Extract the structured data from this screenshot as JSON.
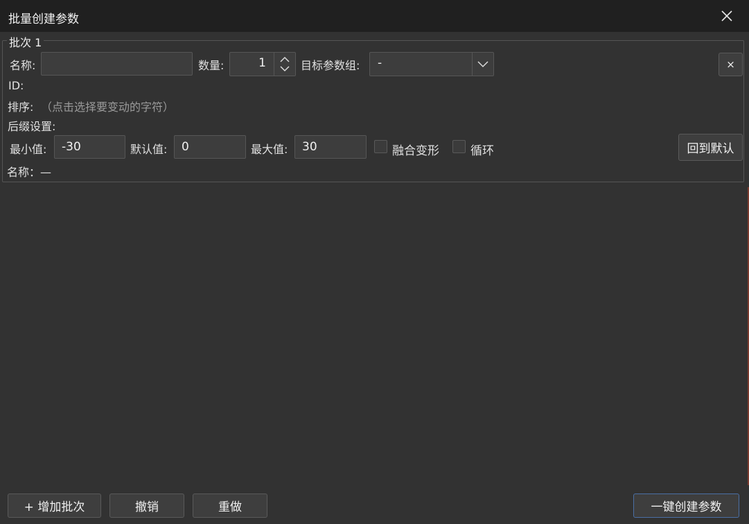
{
  "window": {
    "title": "批量创建参数"
  },
  "batch": {
    "legend": "批次 1",
    "name_label": "名称:",
    "name_value": "",
    "count_label": "数量:",
    "count_value": "1",
    "target_group_label": "目标参数组:",
    "target_group_value": "-",
    "remove_label": "×",
    "id_label": "ID:",
    "sort_label": "排序:",
    "sort_hint": "（点击选择要变动的字符）",
    "suffix_label": "后缀设置:",
    "min_label": "最小值:",
    "min_value": "-30",
    "default_label": "默认值:",
    "default_value": "0",
    "max_label": "最大值:",
    "max_value": "30",
    "blend_label": "融合变形",
    "blend_checked": false,
    "loop_label": "循环",
    "loop_checked": false,
    "reset_label": "回到默认",
    "preview_name": "名称：—"
  },
  "footer": {
    "add_batch_label": "+ 增加批次",
    "undo_label": "撤销",
    "redo_label": "重做",
    "create_label": "一键创建参数"
  },
  "colors": {
    "background": "#323232",
    "titlebar": "#202020",
    "field": "#3d3d3d",
    "primary_border": "#4a6fa5"
  },
  "icons": {
    "close": "close-icon",
    "spin": "spin-arrows-icon",
    "dropdown": "chevron-down-icon"
  }
}
